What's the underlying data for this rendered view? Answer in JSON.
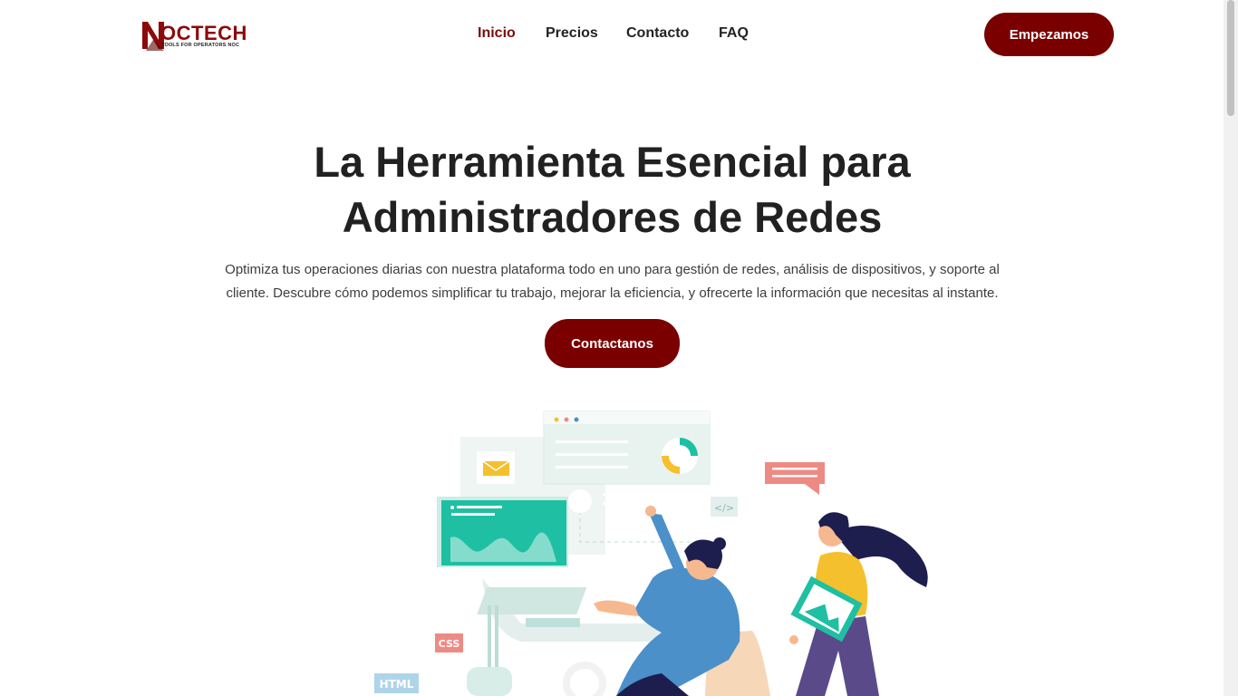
{
  "brand": {
    "name": "OCTECH",
    "tagline": "TOOLS FOR OPERATORS NOC",
    "color": "#8c0a0a"
  },
  "nav": {
    "items": [
      {
        "label": "Inicio",
        "active": true
      },
      {
        "label": "Precios",
        "active": false
      },
      {
        "label": "Contacto",
        "active": false
      },
      {
        "label": "FAQ",
        "active": false
      }
    ],
    "cta_label": "Empezamos"
  },
  "hero": {
    "title_line1": "La Herramienta Esencial para",
    "title_line2": "Administradores de Redes",
    "subtitle": "Optimiza tus operaciones diarias con nuestra plataforma todo en uno para gestión de redes, análisis de dispositivos, y soporte al cliente. Descubre cómo podemos simplificar tu trabajo, mejorar la eficiencia, y ofrecerte la información que necesitas al instante.",
    "cta_label": "Contactanos"
  },
  "illustration": {
    "tags": {
      "css": "CSS",
      "html": "HTML",
      "code": "</>"
    }
  },
  "colors": {
    "accent": "#7a0000",
    "teal": "#1fbfa3",
    "yellow": "#f5c02e",
    "salmon": "#ee8a84",
    "navy": "#1d1d4e"
  }
}
